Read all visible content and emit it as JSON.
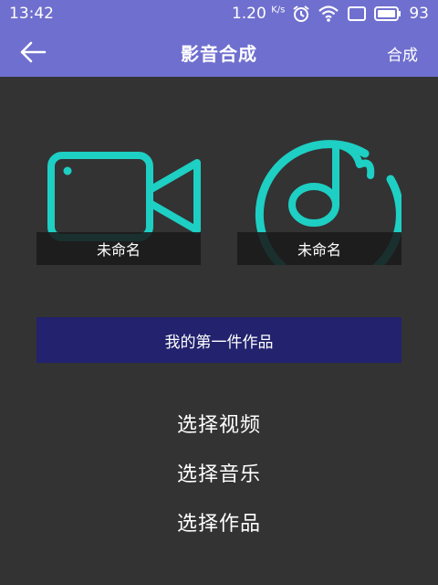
{
  "status_bar": {
    "time": "13:42",
    "net_speed": "1.20",
    "net_speed_unit": "K/s",
    "battery": "93"
  },
  "app_bar": {
    "title": "影音合成",
    "action_label": "合成"
  },
  "video_card": {
    "name": "未命名",
    "icon": "video-camera-icon"
  },
  "music_card": {
    "name": "未命名",
    "icon": "music-note-icon"
  },
  "work_name": "我的第一件作品",
  "choices": {
    "select_video": "选择视频",
    "select_music": "选择音乐",
    "select_work": "选择作品"
  },
  "colors": {
    "header": "#6f6fcf",
    "background": "#333333",
    "accent": "#1ecfc4",
    "work_bar": "#22226e"
  }
}
